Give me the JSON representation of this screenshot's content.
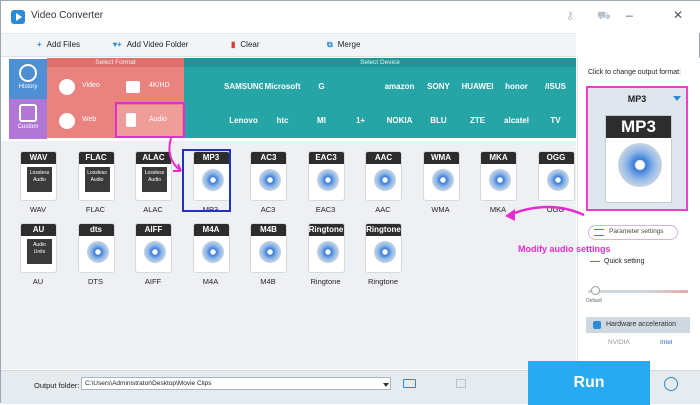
{
  "window": {
    "title": "Video Converter"
  },
  "toolbar": {
    "add_files": "Add Files",
    "add_video_folder": "Add Video Folder",
    "clear": "Clear",
    "merge": "Merge"
  },
  "categories": {
    "history": "History",
    "custom": "Custom"
  },
  "select_format": {
    "title": "Select Format",
    "items": [
      {
        "label": "Video"
      },
      {
        "label": "4K/HD"
      },
      {
        "label": "Web"
      },
      {
        "label": "Audio"
      }
    ]
  },
  "select_device": {
    "title": "Select Device",
    "brands_row1": [
      "",
      "SAMSUNG",
      "Microsoft",
      "G",
      "",
      "amazon",
      "SONY",
      "HUAWEI",
      "honor",
      "/ISUS"
    ],
    "brands_row2": [
      "",
      "Lenovo",
      "htc",
      "MI",
      "1+",
      "NOKIA",
      "BLU",
      "ZTE",
      "alcatel",
      "TV"
    ]
  },
  "formats": [
    {
      "name": "WAV",
      "cap": "WAV",
      "badge": "Lossless Audio"
    },
    {
      "name": "FLAC",
      "cap": "FLAC",
      "badge": "Lossless Audio"
    },
    {
      "name": "ALAC",
      "cap": "ALAC",
      "badge": "Lossless Audio"
    },
    {
      "name": "MP3",
      "cap": "MP3",
      "badge": ""
    },
    {
      "name": "AC3",
      "cap": "AC3",
      "badge": ""
    },
    {
      "name": "EAC3",
      "cap": "EAC3",
      "badge": ""
    },
    {
      "name": "AAC",
      "cap": "AAC",
      "badge": ""
    },
    {
      "name": "WMA",
      "cap": "WMA",
      "badge": ""
    },
    {
      "name": "MKA",
      "cap": "MKA",
      "badge": ""
    },
    {
      "name": "OGG",
      "cap": "OGG",
      "badge": ""
    },
    {
      "name": "AU",
      "cap": "AU",
      "badge": "Audio Units"
    },
    {
      "name": "DTS",
      "cap": "dts",
      "badge": ""
    },
    {
      "name": "AIFF",
      "cap": "AIFF",
      "badge": ""
    },
    {
      "name": "M4A",
      "cap": "M4A",
      "badge": ""
    },
    {
      "name": "M4B",
      "cap": "M4B",
      "badge": ""
    },
    {
      "name": "Ringtone",
      "cap": "Ringtone",
      "badge": ""
    },
    {
      "name": "Ringtone",
      "cap": "Ringtone",
      "badge": ""
    }
  ],
  "right_panel": {
    "click_label": "Click to change output format:",
    "current_format": "MP3",
    "card_caption": "MP3",
    "parameter_settings": "Parameter settings",
    "quick_setting": "Quick setting",
    "quality_level": 0.05,
    "default_label": "Default",
    "hardware_acceleration": "Hardware acceleration",
    "nvidia": "NVIDIA",
    "intel": "Intel"
  },
  "annotation": {
    "modify_audio": "Modify audio settings",
    "color": "#e62bd0"
  },
  "bottom": {
    "output_folder_label": "Output folder:",
    "output_path": "C:\\Users\\Administrator\\Desktop\\Movie Clips",
    "run": "Run"
  },
  "colors": {
    "format_section": "#e8837f",
    "device_section": "#25a5a6",
    "run": "#28aaf1",
    "selection": "#2233bb"
  }
}
